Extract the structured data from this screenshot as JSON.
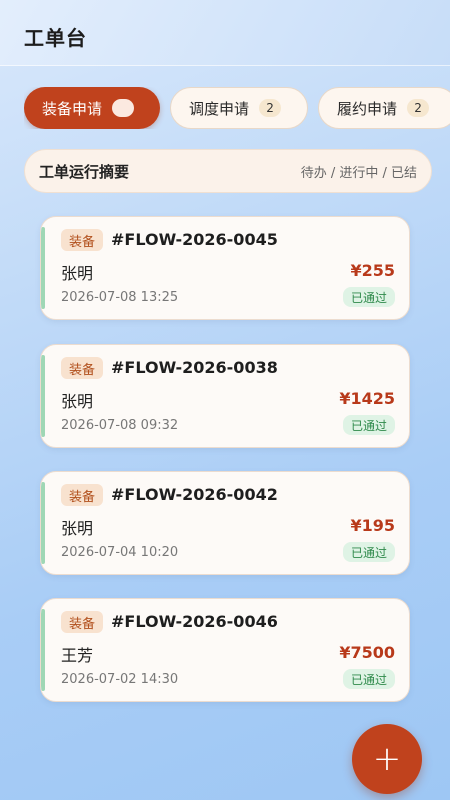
{
  "header": {
    "title": "工单台"
  },
  "tabs": [
    {
      "label": "装备申请",
      "count": ""
    },
    {
      "label": "调度申请",
      "count": "2"
    },
    {
      "label": "履约申请",
      "count": "2"
    }
  ],
  "summary": {
    "title": "工单运行摘要",
    "status_text": "待办 / 进行中 / 已结"
  },
  "orders": [
    {
      "type": "装备",
      "id": "#FLOW-2026-0045",
      "person": "张明",
      "amount": "¥255",
      "datetime": "2026-07-08 13:25",
      "status": "已通过"
    },
    {
      "type": "装备",
      "id": "#FLOW-2026-0038",
      "person": "张明",
      "amount": "¥1425",
      "datetime": "2026-07-08 09:32",
      "status": "已通过"
    },
    {
      "type": "装备",
      "id": "#FLOW-2026-0042",
      "person": "张明",
      "amount": "¥195",
      "datetime": "2026-07-04 10:20",
      "status": "已通过"
    },
    {
      "type": "装备",
      "id": "#FLOW-2026-0046",
      "person": "王芳",
      "amount": "¥7500",
      "datetime": "2026-07-02 14:30",
      "status": "已通过"
    }
  ],
  "fab": {
    "icon": "plus-icon",
    "glyph": "+"
  },
  "colors": {
    "accent": "#c0421d",
    "status_green": "#2f8a4b",
    "amount_red": "#b8391a"
  }
}
